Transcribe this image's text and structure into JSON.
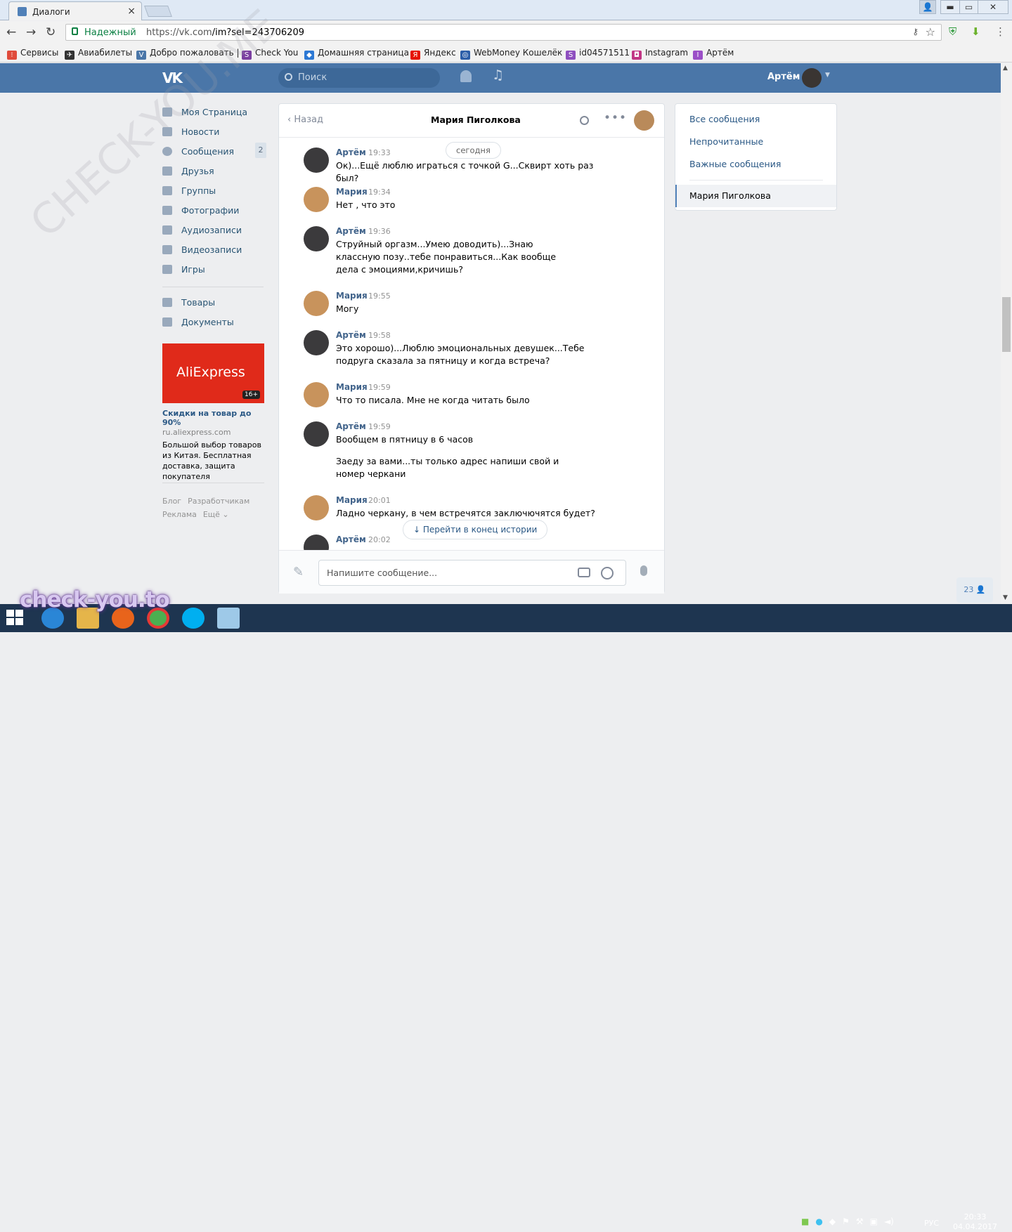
{
  "browser": {
    "tab_title": "Диалоги",
    "tab_close": "×",
    "security_label": "Надежный",
    "url_host": "https://vk.com",
    "url_path": "/im?sel=243706209",
    "window_buttons": [
      "▬",
      "▭",
      "✕"
    ],
    "bookmarks": [
      {
        "label": "Сервисы",
        "icon": "apps-icon",
        "color": "#e04b3b",
        "glyph": "⁝"
      },
      {
        "label": "Авиабилеты",
        "icon": "plane-icon",
        "color": "#333333",
        "glyph": "✈"
      },
      {
        "label": "Добро пожаловать |",
        "icon": "vk-icon",
        "color": "#4a76a8",
        "glyph": "V"
      },
      {
        "label": "Check You",
        "icon": "checkyou-icon",
        "color": "#7b3fa0",
        "glyph": "S"
      },
      {
        "label": "Домашняя страница",
        "icon": "dropbox-icon",
        "color": "#2c78d4",
        "glyph": "◆"
      },
      {
        "label": "Яндекс",
        "icon": "yandex-icon",
        "color": "#e61400",
        "glyph": "Я"
      },
      {
        "label": "WebMoney Кошелёк",
        "icon": "webmoney-icon",
        "color": "#2c5ea8",
        "glyph": "◎"
      },
      {
        "label": "id04571511",
        "icon": "skype-s-icon",
        "color": "#8e4fbf",
        "glyph": "S"
      },
      {
        "label": "Instagram",
        "icon": "instagram-icon",
        "color": "#c13584",
        "glyph": "◘"
      },
      {
        "label": "Артём",
        "icon": "person-icon",
        "color": "#9b4fc7",
        "glyph": "I"
      }
    ]
  },
  "vk": {
    "search_placeholder": "Поиск",
    "user_name": "Артём",
    "logo": "VK"
  },
  "watermark": "CHECK-YOU.ME",
  "sidebar": {
    "items": [
      {
        "label": "Моя Страница",
        "icon": "home-icon"
      },
      {
        "label": "Новости",
        "icon": "news-icon"
      },
      {
        "label": "Сообщения",
        "icon": "messages-icon",
        "count": "2"
      },
      {
        "label": "Друзья",
        "icon": "friends-icon"
      },
      {
        "label": "Группы",
        "icon": "groups-icon"
      },
      {
        "label": "Фотографии",
        "icon": "photos-icon"
      },
      {
        "label": "Аудиозаписи",
        "icon": "audio-icon"
      },
      {
        "label": "Видеозаписи",
        "icon": "video-icon"
      },
      {
        "label": "Игры",
        "icon": "games-icon"
      }
    ],
    "items2": [
      {
        "label": "Товары",
        "icon": "goods-icon"
      },
      {
        "label": "Документы",
        "icon": "docs-icon"
      }
    ]
  },
  "ad": {
    "brand": "AliExpress",
    "age": "16+",
    "title": "Скидки на товар до 90%",
    "domain": "ru.aliexpress.com",
    "text": "Большой выбор товаров из Китая. Бесплатная доставка, защита покупателя"
  },
  "footer": {
    "links": [
      "Блог",
      "Разработчикам",
      "Реклама",
      "Ещё ⌄"
    ]
  },
  "chat": {
    "back": "Назад",
    "title": "Мария Пиголкова",
    "more": "•••",
    "today": "сегодня",
    "jump": "Перейти в конец истории",
    "input_placeholder": "Напишите сообщение...",
    "messages": [
      {
        "author": "Артём",
        "time": "19:33",
        "text": "Ок)...Ещё люблю играться с точкой G...Сквирт хоть раз был?"
      },
      {
        "author": "Мария",
        "time": "19:34",
        "text": "Нет , что это"
      },
      {
        "author": "Артём",
        "time": "19:36",
        "text": "Струйный оргазм...Умею доводить)...Знаю классную позу..тебе понравиться...Как вообще дела с эмоциями,кричишь?"
      },
      {
        "author": "Мария",
        "time": "19:55",
        "text": "Могу"
      },
      {
        "author": "Артём",
        "time": "19:58",
        "text": "Это хорошо)...Люблю эмоциональных девушек...Тебе подруга сказала за пятницу и когда встреча?"
      },
      {
        "author": "Мария",
        "time": "19:59",
        "text": "Что то писала. Мне не когда читать было"
      },
      {
        "author": "Артём",
        "time": "19:59",
        "text": "Вообщем в пятницу в 6 часов",
        "text2": "Заеду за вами...ты только адрес напиши свой и номер черкани"
      },
      {
        "author": "Мария",
        "time": "20:01",
        "text": "Ладно черкану, в чем встречятся заключючятся будет?"
      },
      {
        "author": "Артём",
        "time": "20:02",
        "text": ""
      }
    ]
  },
  "right_nav": {
    "all": "Все сообщения",
    "unread": "Непрочитанные",
    "important": "Важные сообщения",
    "active": "Мария Пиголкова"
  },
  "online_count": "23",
  "taskbar": {
    "overlay": "check-you.to",
    "lang": "РУС",
    "time": "20:33",
    "date": "04.04.2017"
  }
}
